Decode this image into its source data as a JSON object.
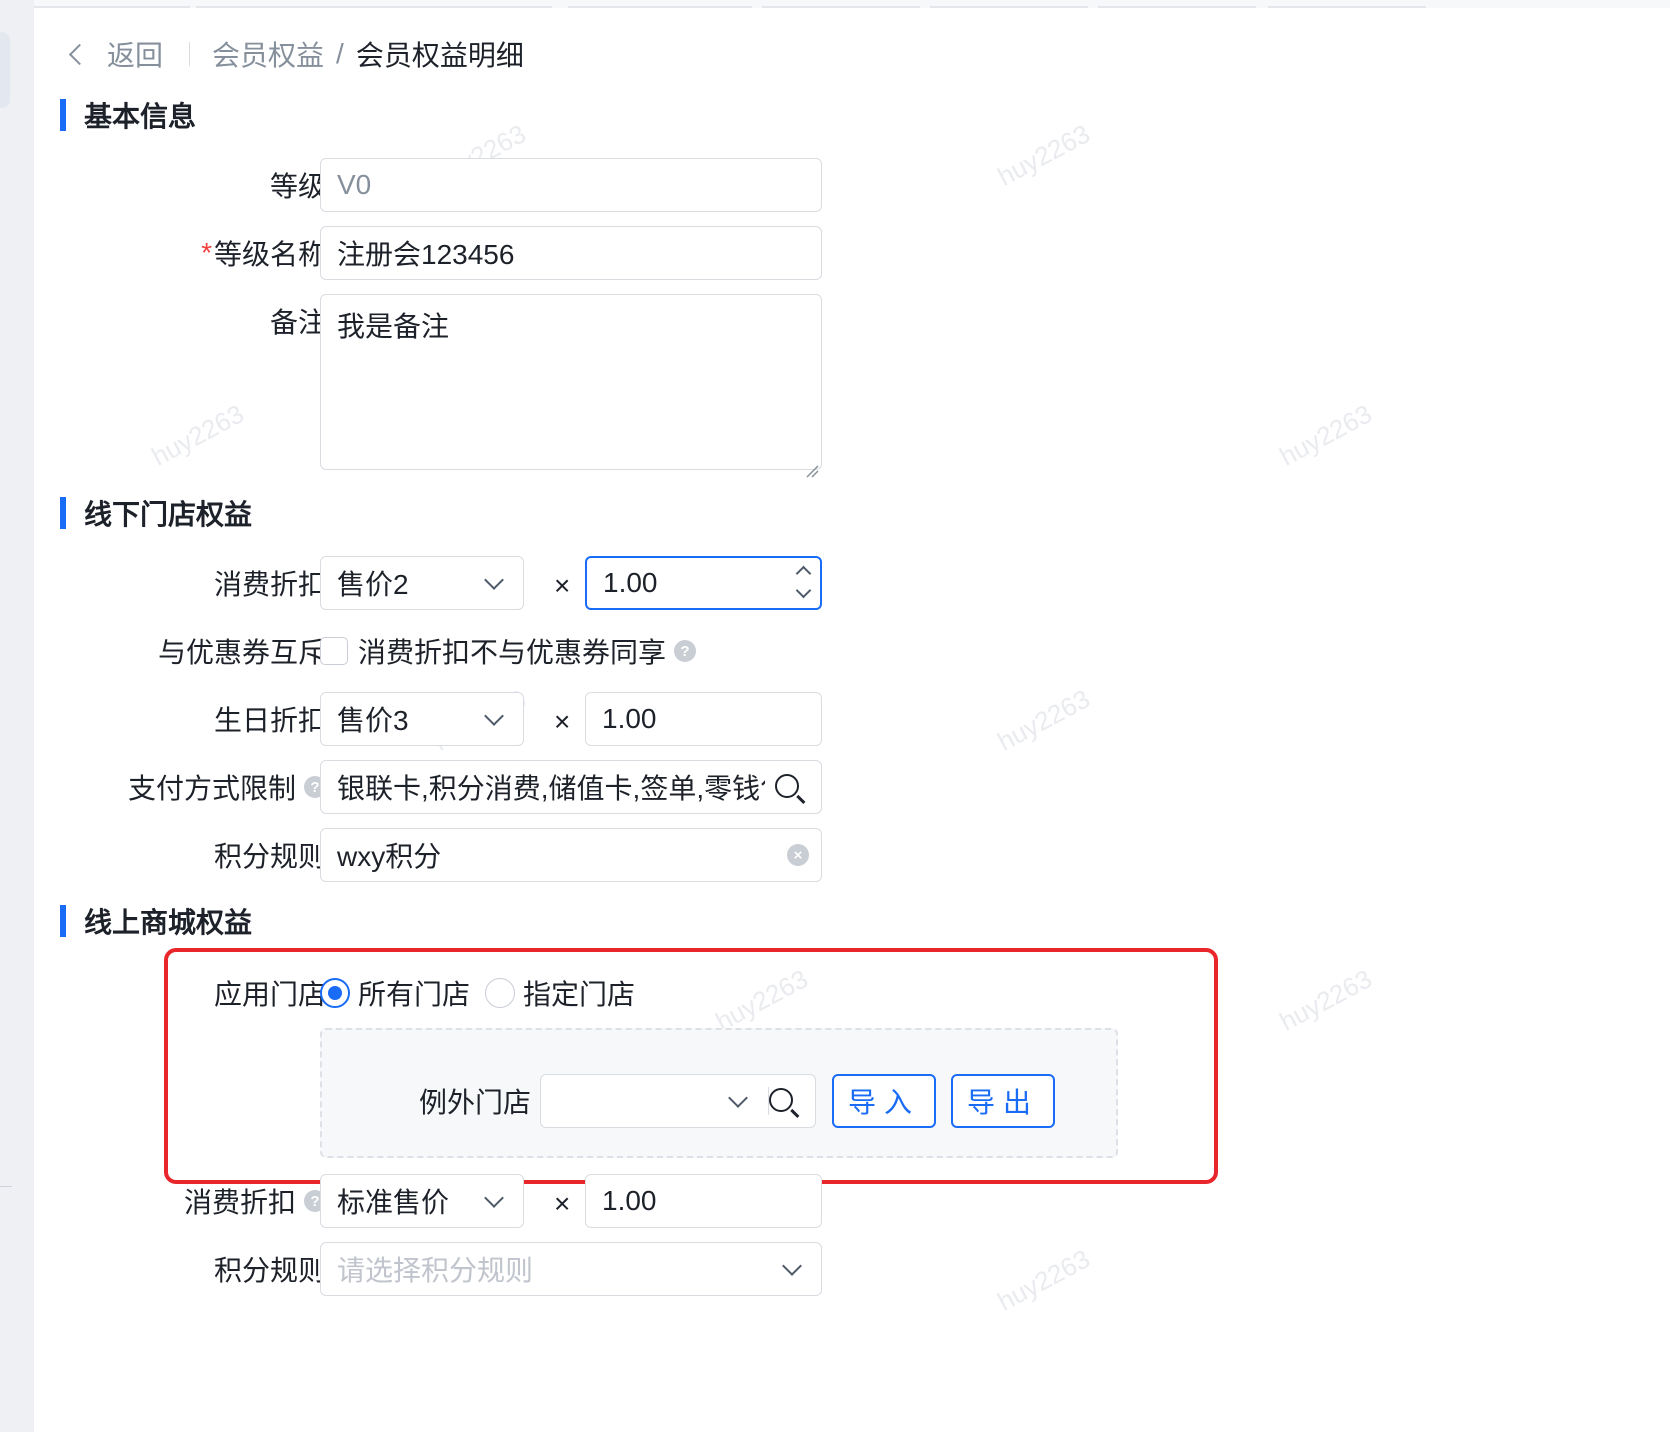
{
  "breadcrumb": {
    "back_label": "返回",
    "parent": "会员权益",
    "separator": "/",
    "current": "会员权益明细"
  },
  "sections": {
    "basic": "基本信息",
    "offline": "线下门店权益",
    "online": "线上商城权益"
  },
  "basic": {
    "level_label": "等级",
    "level_value": "V0",
    "name_label": "等级名称",
    "name_value": "注册会123456",
    "required_mark": "*",
    "remark_label": "备注",
    "remark_value": "我是备注"
  },
  "offline": {
    "discount_label": "消费折扣",
    "discount_select": "售价2",
    "times": "×",
    "discount_value": "1.00",
    "coupon_label": "与优惠券互斥",
    "coupon_checkbox_text": "消费折扣不与优惠券同享",
    "birthday_label": "生日折扣",
    "birthday_select": "售价3",
    "birthday_value": "1.00",
    "payment_label": "支付方式限制",
    "payment_value": "银联卡,积分消费,储值卡,签单,零钱包,:",
    "points_label": "积分规则",
    "points_value": "wxy积分"
  },
  "online": {
    "store_label": "应用门店",
    "radio_all": "所有门店",
    "radio_specific": "指定门店",
    "exception_label": "例外门店",
    "import_label": "导入",
    "export_label": "导出",
    "discount_label": "消费折扣",
    "discount_select": "标准售价",
    "discount_value": "1.00",
    "points_label": "积分规则",
    "points_placeholder": "请选择积分规则"
  },
  "help_glyph": "?",
  "clear_glyph": "×",
  "watermark": "huy2263",
  "colors": {
    "primary": "#1a6cf6",
    "highlight_frame": "#e8262b",
    "required": "#f53f3f"
  }
}
